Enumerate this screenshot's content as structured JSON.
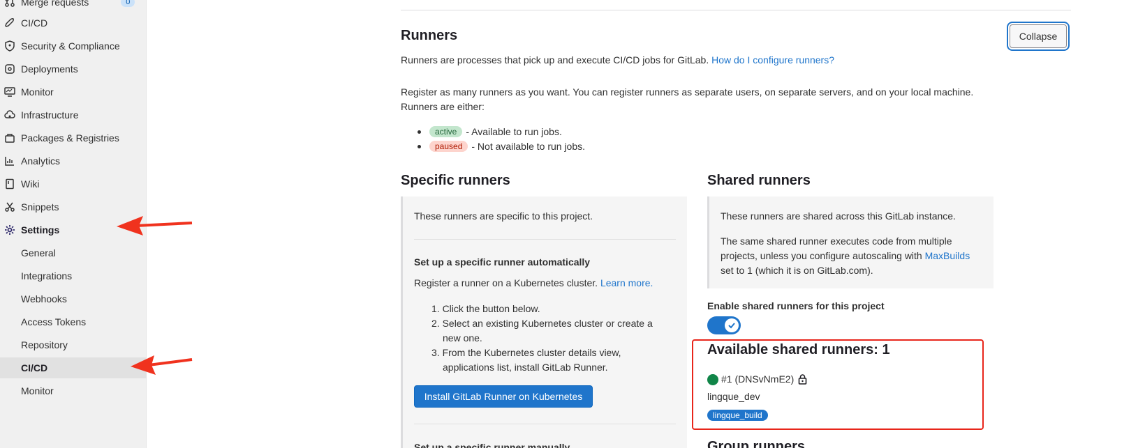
{
  "sidebar": {
    "items": [
      {
        "label": "Merge requests",
        "icon": "merge-request-icon",
        "badge": "0"
      },
      {
        "label": "CI/CD",
        "icon": "rocket-icon"
      },
      {
        "label": "Security & Compliance",
        "icon": "shield-icon"
      },
      {
        "label": "Deployments",
        "icon": "deployments-icon"
      },
      {
        "label": "Monitor",
        "icon": "monitor-icon"
      },
      {
        "label": "Infrastructure",
        "icon": "cloud-gear-icon"
      },
      {
        "label": "Packages & Registries",
        "icon": "package-icon"
      },
      {
        "label": "Analytics",
        "icon": "chart-icon"
      },
      {
        "label": "Wiki",
        "icon": "book-icon"
      },
      {
        "label": "Snippets",
        "icon": "scissors-icon"
      },
      {
        "label": "Settings",
        "icon": "gear-icon"
      }
    ],
    "settings_sub": [
      "General",
      "Integrations",
      "Webhooks",
      "Access Tokens",
      "Repository",
      "CI/CD",
      "Monitor"
    ]
  },
  "runners": {
    "title": "Runners",
    "collapse_label": "Collapse",
    "intro": "Runners are processes that pick up and execute CI/CD jobs for GitLab.",
    "intro_link": "How do I configure runners?",
    "register_line1": "Register as many runners as you want. You can register runners as separate users, on separate servers, and on your local machine.",
    "register_line2": "Runners are either:",
    "active_badge": "active",
    "active_desc": "- Available to run jobs.",
    "paused_badge": "paused",
    "paused_desc": "- Not available to run jobs."
  },
  "specific": {
    "title": "Specific runners",
    "desc": "These runners are specific to this project.",
    "auto_title": "Set up a specific runner automatically",
    "auto_desc": "Register a runner on a Kubernetes cluster.",
    "learn_more": "Learn more.",
    "steps": [
      "1. Click the button below.",
      "2. Select an existing Kubernetes cluster or create a",
      "new one.",
      "3. From the Kubernetes cluster details view,",
      "applications list, install GitLab Runner."
    ],
    "install_button": "Install GitLab Runner on Kubernetes",
    "manual_title": "Set up a specific runner manually"
  },
  "shared": {
    "title": "Shared runners",
    "desc1": "These runners are shared across this GitLab instance.",
    "desc2_a": "The same shared runner executes code from multiple",
    "desc2_b": "projects, unless you configure autoscaling with",
    "desc2_link": "MaxBuilds",
    "desc2_c": "set to 1 (which it is on GitLab.com).",
    "enable_label": "Enable shared runners for this project",
    "available_title": "Available shared runners: 1",
    "runner_id": "#1 (DNSvNmE2)",
    "runner_name": "lingque_dev",
    "runner_tag": "lingque_build",
    "group_title": "Group runners"
  },
  "colors": {
    "accent": "#1f75cb",
    "highlight": "#e8261b",
    "online": "#108548"
  }
}
